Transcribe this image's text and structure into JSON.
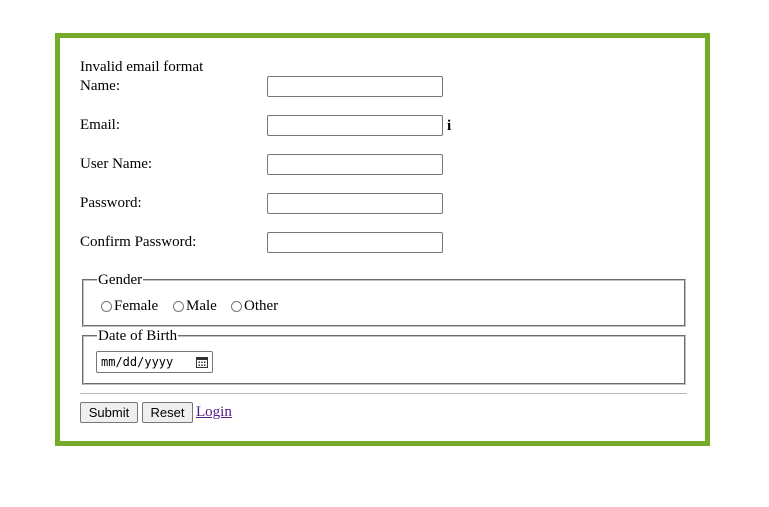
{
  "form": {
    "error_message": "Invalid email format",
    "fields": {
      "name": {
        "label": "Name:",
        "value": ""
      },
      "email": {
        "label": "Email:",
        "value": "",
        "info_icon": "i"
      },
      "username": {
        "label": "User Name:",
        "value": ""
      },
      "password": {
        "label": "Password:",
        "value": ""
      },
      "confirm_password": {
        "label": "Confirm Password:",
        "value": ""
      }
    },
    "gender": {
      "legend": "Gender",
      "options": [
        "Female",
        "Male",
        "Other"
      ],
      "selected": null
    },
    "dob": {
      "legend": "Date of Birth",
      "placeholder": "mm/dd/yyyy",
      "icon": "calendar-icon"
    },
    "buttons": {
      "submit_label": "Submit",
      "reset_label": "Reset"
    },
    "login_link": "Login"
  },
  "colors": {
    "border_accent": "#74ab2a",
    "link_visited": "#551a8b"
  }
}
